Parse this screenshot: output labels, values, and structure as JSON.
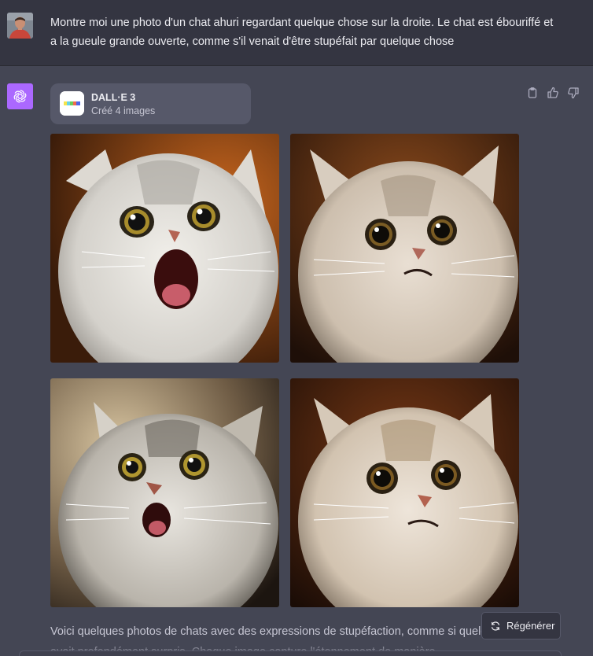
{
  "user": {
    "message": "Montre moi une photo d'un chat ahuri regardant quelque chose sur la droite. Le chat est ébouriffé et a la gueule grande ouverte, comme s'il venait d'être stupéfait par quelque chose"
  },
  "assistant": {
    "tool_card": {
      "title": "DALL·E 3",
      "subtitle": "Créé 4 images"
    },
    "images": [
      {
        "alt": "chat ébouriffé gueule ouverte"
      },
      {
        "alt": "chat surpris regardant à droite"
      },
      {
        "alt": "chat ahuri gueule ouverte"
      },
      {
        "alt": "chat stupéfait regardant à droite"
      }
    ],
    "response": "Voici quelques photos de chats avec des expressions de stupéfaction, comme si quelque chose les avait profondément surpris. Chaque image capture l'étonnement de manière",
    "regenerate_label": "Régénérer"
  },
  "icons": [
    "user-avatar",
    "openai-logo-icon",
    "dalle-logo-icon",
    "clipboard-icon",
    "thumbs-up-icon",
    "thumbs-down-icon",
    "refresh-icon"
  ],
  "colors": {
    "user_bg": "#343541",
    "assistant_bg": "#444654",
    "gpt_avatar": "#ab68ff",
    "card_bg": "#565869"
  }
}
